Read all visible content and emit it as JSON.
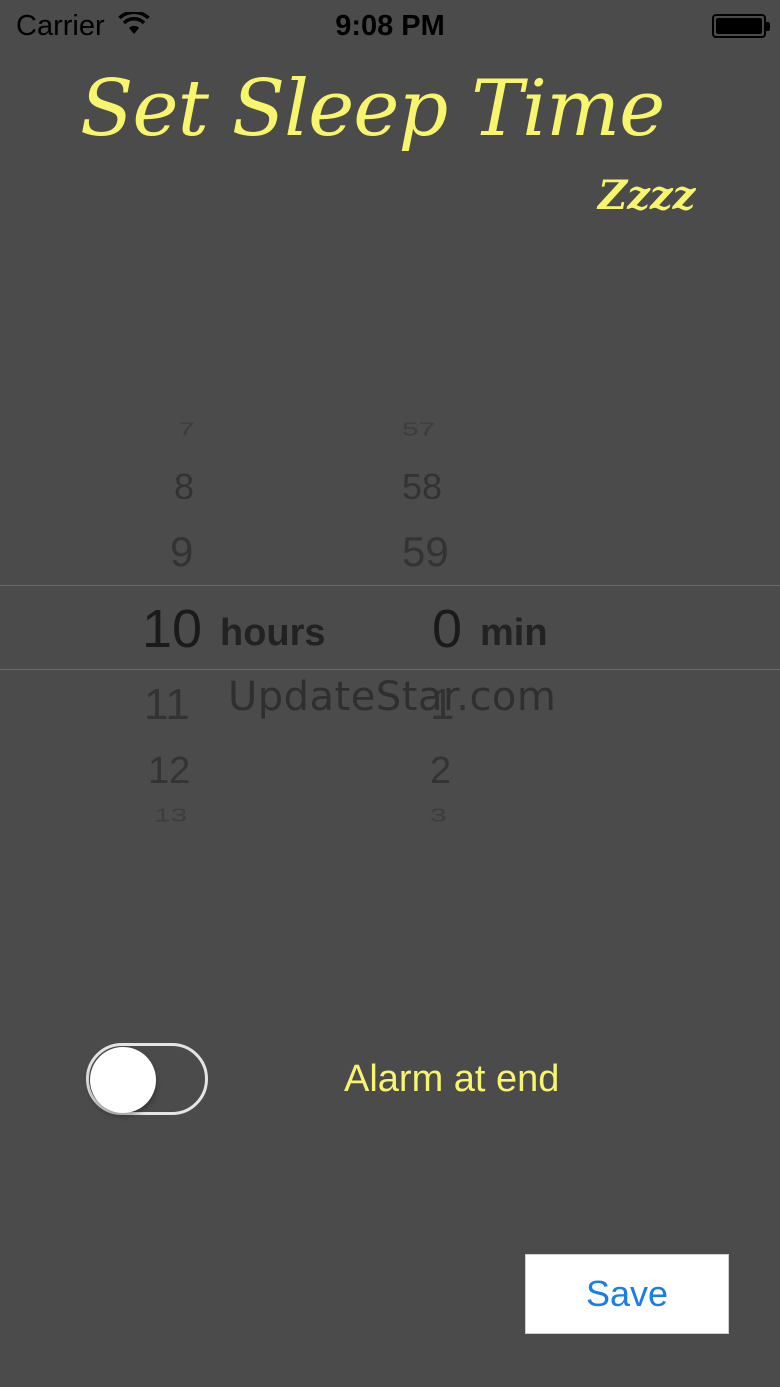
{
  "status_bar": {
    "carrier": "Carrier",
    "time": "9:08 PM",
    "wifi_icon": "wifi-icon",
    "battery_icon": "battery-icon"
  },
  "header": {
    "title": "Set Sleep Time",
    "subtitle": "Zzzz"
  },
  "picker": {
    "hours": {
      "above": [
        "7",
        "8",
        "9"
      ],
      "selected": "10",
      "below": [
        "11",
        "12",
        "13"
      ],
      "unit": "hours"
    },
    "minutes": {
      "above": [
        "57",
        "58",
        "59"
      ],
      "selected": "0",
      "below": [
        "1",
        "2",
        "3"
      ],
      "unit": "min"
    }
  },
  "watermark": "UpdateStar.com",
  "alarm": {
    "label": "Alarm at end",
    "enabled": false
  },
  "save_button": {
    "label": "Save"
  },
  "colors": {
    "background": "#4b4b4b",
    "accent_yellow": "#f7f56e",
    "button_blue": "#1a7ee8"
  }
}
